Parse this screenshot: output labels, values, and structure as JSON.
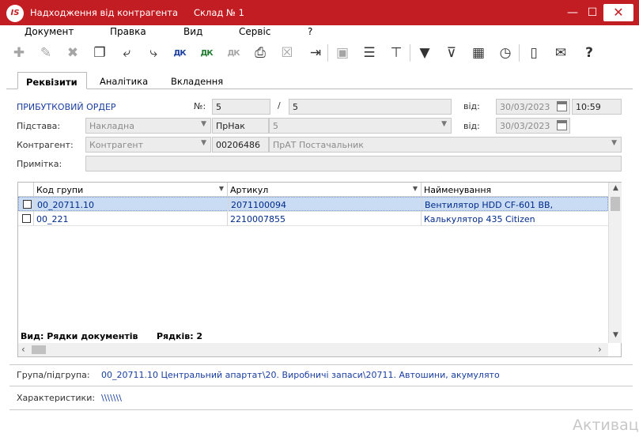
{
  "window": {
    "title": "Надходження від контрагента",
    "subtitle": "Склад № 1",
    "logo_text": "IS",
    "minimize": "—",
    "maximize": "☐",
    "close": "✕"
  },
  "menu": [
    "Документ",
    "Правка",
    "Вид",
    "Сервіс",
    "?"
  ],
  "toolbar": {
    "dk1": "ДК",
    "dk2": "ДК",
    "dk3": "ДК",
    "icons": [
      "add-doc-icon",
      "edit-doc-icon",
      "delete-doc-icon",
      "copy-icon",
      "import-icon",
      "export-icon",
      "dk-debit-icon",
      "dk-credit-icon",
      "dk-disabled-icon",
      "print-icon",
      "excel-icon",
      "exit-icon",
      "save-icon",
      "list-icon",
      "hierarchy-icon",
      "filter-icon",
      "clear-filter-icon",
      "table-icon",
      "history-icon",
      "notebook-icon",
      "mail-icon",
      "help-icon"
    ]
  },
  "tabs": [
    "Реквізити",
    "Аналітика",
    "Вкладення"
  ],
  "form": {
    "doc_type": "ПРИБУТКОВИЙ ОРДЕР",
    "num_label": "№:",
    "num_value": "5",
    "slash": "/",
    "num2_value": "5",
    "date_label": "від:",
    "date_value": "30/03/2023",
    "time_value": "10:59",
    "basis_label": "Підстава:",
    "basis_value": "Накладна",
    "prnak_label": "ПрНак",
    "prnak_value": "5",
    "date2_label": "від:",
    "date2_value": "30/03/2023",
    "contr_label": "Контрагент:",
    "contr_type": "Контрагент",
    "contr_code": "00206486",
    "contr_name": "ПрАТ Постачальник",
    "note_label": "Примітка:",
    "note_value": ""
  },
  "grid": {
    "columns": [
      "Код групи",
      "Артикул",
      "Найменування"
    ],
    "rows": [
      {
        "group": "00_20711.10",
        "article": "2071100094",
        "name": "Вентилятор HDD CF-601 BB,"
      },
      {
        "group": "00_221",
        "article": "2210007855",
        "name": "Калькулятор 435 Citizen"
      }
    ],
    "view_text": "Вид: Рядки документів",
    "rows_text": "Рядків: 2"
  },
  "bottom": {
    "group_label": "Група/підгрупа:",
    "group_value": "00_20711.10 Центральний апартат\\20. Виробничі запаси\\20711. Автошини, акумулято",
    "char_label": "Характеристики:",
    "char_value": "\\\\\\\\\\\\\\"
  },
  "watermark": "Активаци",
  "colors": {
    "titlebar": "#c21d22",
    "selection": "#c9dcf4",
    "link_blue": "#1a3ea0"
  }
}
